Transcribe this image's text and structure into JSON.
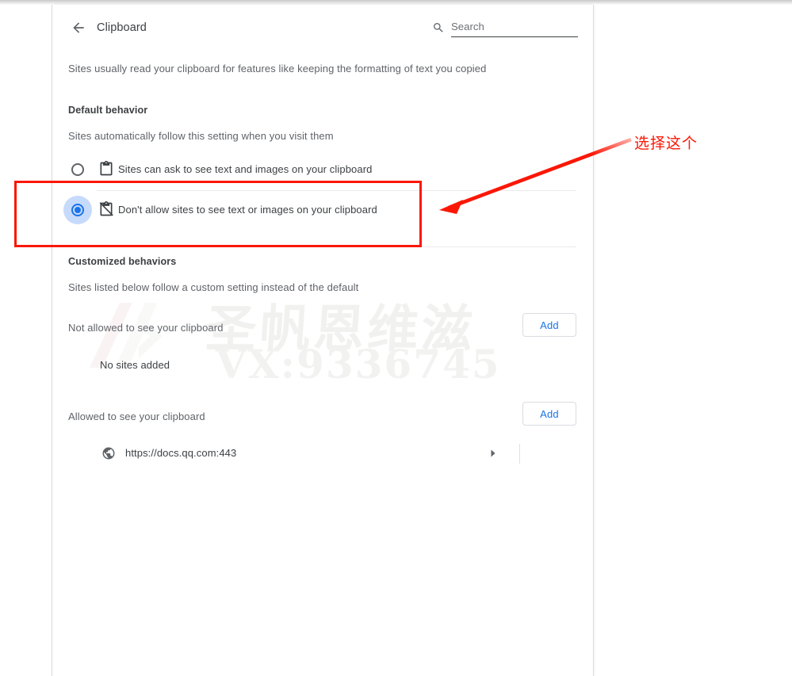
{
  "header": {
    "back_icon": "arrow-left-icon",
    "title": "Clipboard",
    "search_icon": "search-icon",
    "search_placeholder": "Search",
    "search_value": ""
  },
  "intro": {
    "description": "Sites usually read your clipboard for features like keeping the formatting of text you copied"
  },
  "default_behavior": {
    "heading": "Default behavior",
    "subtext": "Sites automatically follow this setting when you visit them",
    "options": [
      {
        "id": "ask",
        "icon": "clipboard-icon",
        "label": "Sites can ask to see text and images on your clipboard",
        "selected": false
      },
      {
        "id": "block",
        "icon": "clipboard-off-icon",
        "label": "Don't allow sites to see text or images on your clipboard",
        "selected": true
      }
    ]
  },
  "customized_behaviors": {
    "heading": "Customized behaviors",
    "subtext": "Sites listed below follow a custom setting instead of the default",
    "blocked_group": {
      "label": "Not allowed to see your clipboard",
      "add_label": "Add",
      "empty_text": "No sites added"
    },
    "allowed_group": {
      "label": "Allowed to see your clipboard",
      "add_label": "Add",
      "sites": [
        {
          "icon": "globe-icon",
          "url": "https://docs.qq.com:443",
          "expand_icon": "triangle-right-icon",
          "menu_icon": "kebab-menu-icon"
        }
      ]
    }
  },
  "annotations": {
    "note_text": "选择这个",
    "note_color": "#fb1705",
    "box_color": "#fb1705",
    "arrow_icon": "arrow-left-annotation"
  },
  "watermark": {
    "chinese": "圣帆恩维滋",
    "contact": "VX:9336745"
  },
  "colors": {
    "accent": "#1a73e8",
    "radio_highlight": "#c6dafc",
    "text_primary": "#3c4043",
    "text_secondary": "#5f6368",
    "border": "#dadce0"
  }
}
